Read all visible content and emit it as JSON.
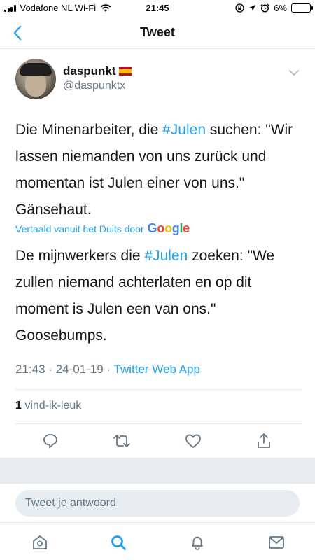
{
  "status_bar": {
    "carrier": "Vodafone NL Wi-Fi",
    "time": "21:45",
    "battery": "6%",
    "battery_level": 0.06
  },
  "header": {
    "title": "Tweet"
  },
  "tweet": {
    "display_name": "daspunkt",
    "username": "@daspunktx",
    "text_parts": [
      "Die Minenarbeiter, die ",
      "#Julen",
      " suchen: \"Wir lassen niemanden von uns zurück und momentan ist Julen einer von uns.\" Gänsehaut."
    ],
    "translated_label": "Vertaald vanuit het Duits door",
    "translated_provider": "Google",
    "translation_parts": [
      "De mijnwerkers die ",
      "#Julen",
      " zoeken: \"We zullen niemand achterlaten en op dit moment is Julen een van ons.\" Goosebumps."
    ],
    "timestamp": "21:43 · 24-01-19 · ",
    "source": "Twitter Web App",
    "likes_count": "1",
    "likes_label": " vind-ik-leuk"
  },
  "reply": {
    "placeholder": "Tweet je antwoord"
  },
  "colors": {
    "accent": "#1da1f2",
    "secondary_text": "#657786",
    "band": "#e6ecf0"
  }
}
